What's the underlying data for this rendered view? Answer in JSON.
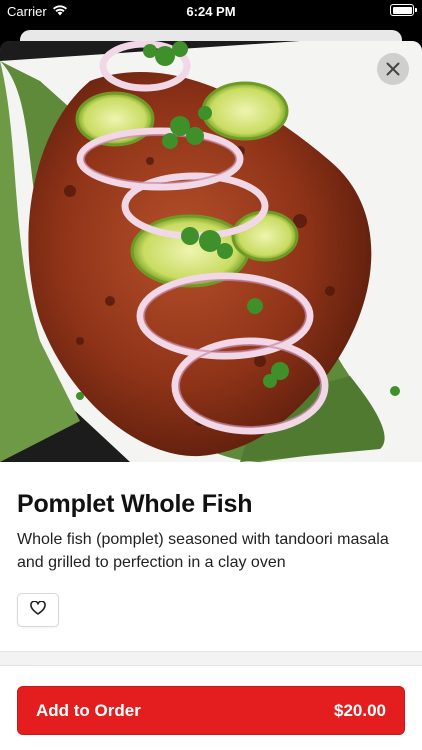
{
  "status": {
    "carrier": "Carrier",
    "time": "6:24 PM"
  },
  "item": {
    "name": "Pomplet Whole Fish",
    "description": "Whole fish (pomplet) seasoned with tandoori masala and grilled to perfection in a clay oven",
    "image": "grilled-pomfret-photo"
  },
  "order": {
    "button_label": "Add to Order",
    "price": "$20.00"
  },
  "colors": {
    "accent": "#e41e1e",
    "text": "#111111"
  },
  "icons": {
    "close": "close-icon",
    "favorite": "heart-icon",
    "wifi": "wifi-icon",
    "battery": "battery-icon"
  }
}
